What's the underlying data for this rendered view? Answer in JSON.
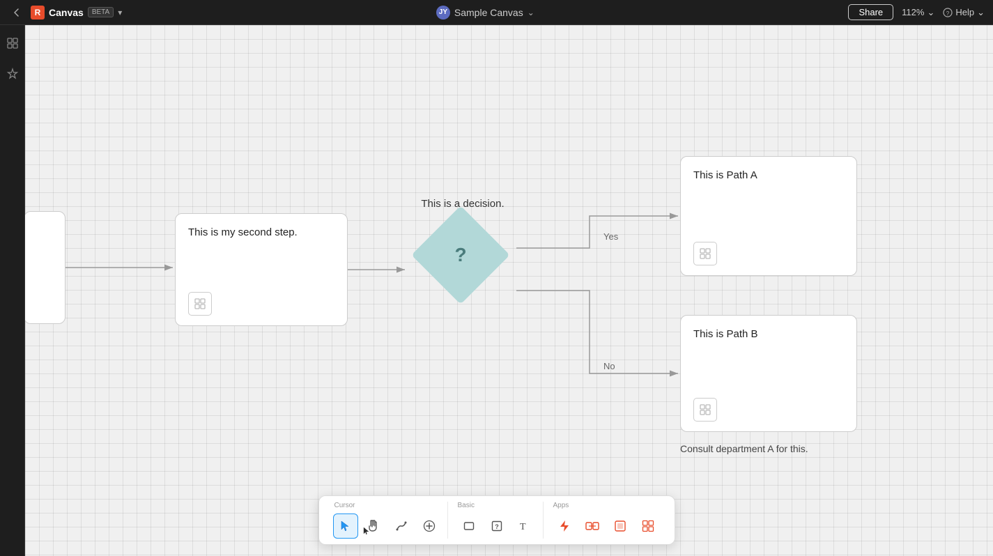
{
  "topbar": {
    "back_label": "←",
    "app_name": "Canvas",
    "beta_label": "BETA",
    "dropdown_arrow": "▾",
    "user_initials": "JY",
    "canvas_title": "Sample Canvas",
    "canvas_dropdown": "⌄",
    "share_label": "Share",
    "zoom_label": "112%",
    "zoom_arrow": "⌄",
    "help_label": "Help",
    "help_arrow": "⌄"
  },
  "sidebar": {
    "icon1": "⊞",
    "icon2": "✦"
  },
  "canvas": {
    "node_partial_label": "",
    "node_step2_title": "This is my second step.",
    "decision_label": "This is a decision.",
    "decision_question": "?",
    "node_path_a_title": "This is Path A",
    "node_path_b_title": "This is Path B",
    "node_path_b_note": "Consult department A for this.",
    "yes_label": "Yes",
    "no_label": "No"
  },
  "toolbar": {
    "cursor_section_label": "Cursor",
    "basic_section_label": "Basic",
    "apps_section_label": "Apps",
    "icons": {
      "cursor": "▲",
      "hand": "✋",
      "path": "⌒",
      "plus": "⊕",
      "rectangle": "▭",
      "question_mark": "?",
      "text": "T",
      "lightning": "⚡",
      "splitarrows": "⇌",
      "square_red": "◻",
      "grid4": "⊞"
    }
  }
}
